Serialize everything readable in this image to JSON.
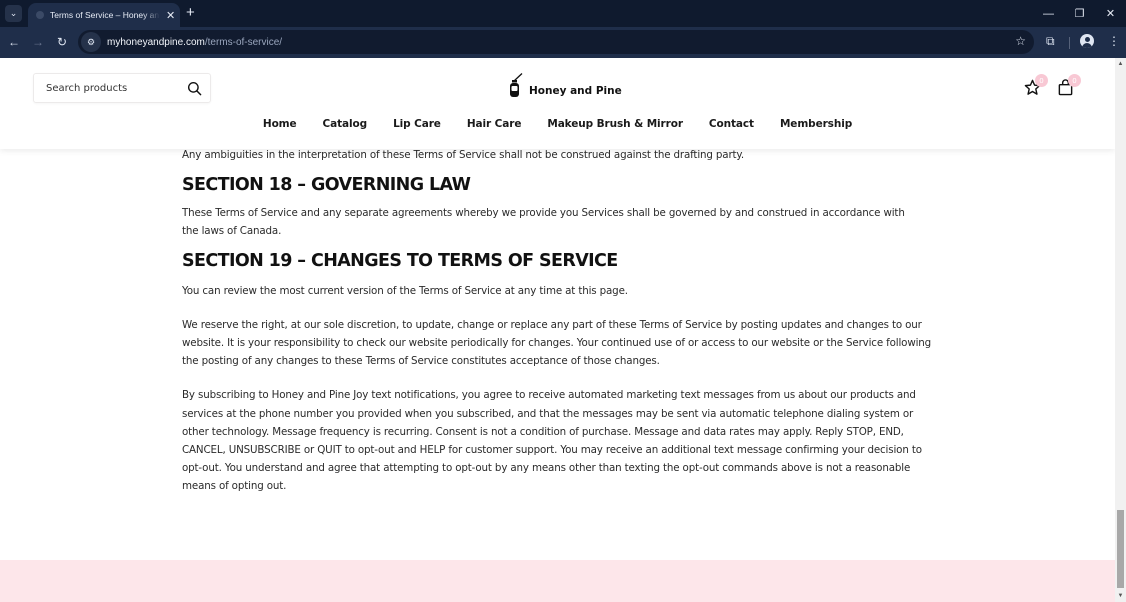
{
  "browser": {
    "tab_title": "Terms of Service – Honey and Pine",
    "url_host": "myhoneyandpine.com",
    "url_path": "/terms-of-service/",
    "icons": {
      "tab_menu": "chevron-down-icon",
      "tab_close": "close-icon",
      "new_tab": "plus-icon",
      "back": "arrow-left-icon",
      "forward": "arrow-right-icon",
      "reload": "reload-icon",
      "site_info": "tune-icon",
      "bookmark": "star-icon",
      "extensions": "puzzle-icon",
      "profile": "person-icon",
      "menu": "kebab-icon"
    },
    "glyphs": {
      "tab_menu": "⌄",
      "tab_close": "✕",
      "new_tab": "+",
      "back": "←",
      "forward": "→",
      "reload": "↻",
      "site_info": "⚙",
      "bookmark": "☆",
      "extensions": "⧉",
      "menu": "⋮",
      "minimize": "—",
      "restore": "❐",
      "close": "✕"
    }
  },
  "header": {
    "search_placeholder": "Search products",
    "brand_name": "Honey and Pine",
    "wishlist_count": "0",
    "cart_count": "0",
    "badge_color": "#f8c8d4",
    "nav": [
      "Home",
      "Catalog",
      "Lip Care",
      "Hair Care",
      "Makeup Brush & Mirror",
      "Contact",
      "Membership"
    ]
  },
  "content": {
    "intro_paragraph": "Any ambiguities in the interpretation of these Terms of Service shall not be construed against the drafting party.",
    "section18": {
      "heading": "SECTION 18 – GOVERNING LAW",
      "paragraph": "These Terms of Service and any separate agreements whereby we provide you Services shall be governed by and construed in accordance with the laws of Canada."
    },
    "section19": {
      "heading": "SECTION 19 – CHANGES TO TERMS OF SERVICE",
      "paragraphs": [
        "You can review the most current version of the Terms of Service at any time at this page.",
        "We reserve the right, at our sole discretion, to update, change or replace any part of these Terms of Service by posting updates and changes to our website. It is your responsibility to check our website periodically for changes. Your continued use of or access to our website or the Service following the posting of any changes to these Terms of Service constitutes acceptance of those changes.",
        "By subscribing to Honey and Pine Joy text notifications, you agree to receive automated marketing text messages from us about our products and services at the phone number you provided when you subscribed, and that the messages may be sent via automatic telephone dialing system or other technology. Message frequency is recurring.  Consent is not a condition of purchase. Message and data rates may apply. Reply STOP, END, CANCEL, UNSUBSCRIBE or QUIT to opt-out and HELP for customer support. You may receive an additional text message confirming your decision to opt-out.  You understand and agree that attempting to opt-out by any means other than texting the opt-out commands above is not a reasonable means of opting out."
      ]
    }
  },
  "colors": {
    "footer_band": "#fde6ea",
    "chrome_dark": "#0f1a2e",
    "chrome_toolbar": "#1f2e4a"
  }
}
